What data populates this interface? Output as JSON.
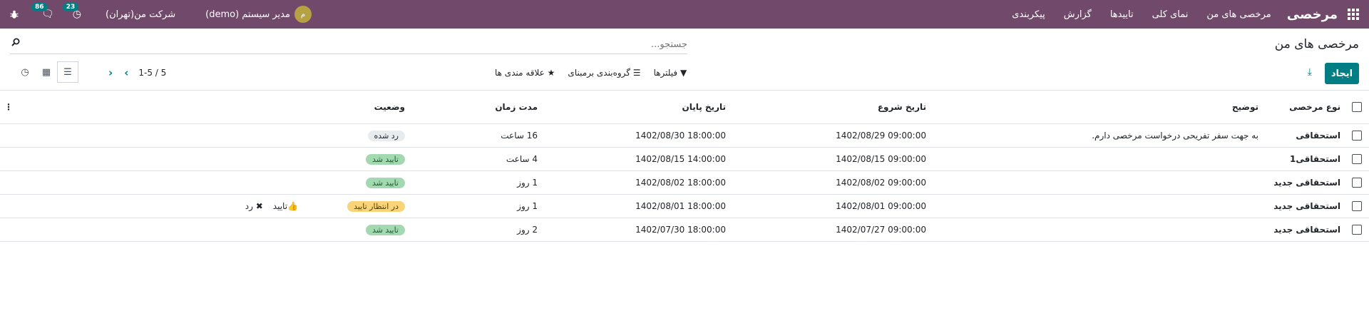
{
  "navbar": {
    "brand": "مرخصی",
    "menu": [
      "مرخصی های من",
      "نمای کلی",
      "تاییدها",
      "گزارش",
      "پیکربندی"
    ],
    "user_name": "مدیر سیستم (demo)",
    "avatar_letter": "م",
    "company": "شرکت من(تهران)",
    "activity_count": "23",
    "messages_count": "86"
  },
  "control_panel": {
    "title": "مرخصی های من",
    "search_placeholder": "جستجو...",
    "create_label": "ایجاد",
    "filters_label": "فیلترها",
    "groupby_label": "گروه‌بندی برمبنای",
    "favorites_label": "علاقه مندی ها",
    "pager": "1-5 / 5"
  },
  "table": {
    "headers": {
      "type": "نوع مرخصی",
      "desc": "توضیح",
      "start": "تاریخ شروع",
      "end": "تاریخ پایان",
      "duration": "مدت زمان",
      "state": "وضعیت"
    },
    "rows": [
      {
        "type": "استحقاقی",
        "desc": "به جهت سفر تفریحی درخواست مرخصی دارم.",
        "start": "1402/08/29 09:00:00",
        "end": "1402/08/30 18:00:00",
        "duration": "16 ساعت",
        "state": "رد شده",
        "state_kind": "refused",
        "approve": "",
        "refuse": ""
      },
      {
        "type": "استحقاقی1",
        "desc": "",
        "start": "1402/08/15 09:00:00",
        "end": "1402/08/15 14:00:00",
        "duration": "4 ساعت",
        "state": "تایید شد",
        "state_kind": "validate",
        "approve": "",
        "refuse": ""
      },
      {
        "type": "استحقاقی جدید",
        "desc": "",
        "start": "1402/08/02 09:00:00",
        "end": "1402/08/02 18:00:00",
        "duration": "1 روز",
        "state": "تایید شد",
        "state_kind": "validate",
        "approve": "",
        "refuse": ""
      },
      {
        "type": "استحقاقی جدید",
        "desc": "",
        "start": "1402/08/01 09:00:00",
        "end": "1402/08/01 18:00:00",
        "duration": "1 روز",
        "state": "در انتظار تایید",
        "state_kind": "confirm",
        "approve": "تایید",
        "refuse": "رد"
      },
      {
        "type": "استحقاقی جدید",
        "desc": "",
        "start": "1402/07/27 09:00:00",
        "end": "1402/07/30 18:00:00",
        "duration": "2 روز",
        "state": "تایید شد",
        "state_kind": "validate",
        "approve": "",
        "refuse": ""
      }
    ]
  }
}
